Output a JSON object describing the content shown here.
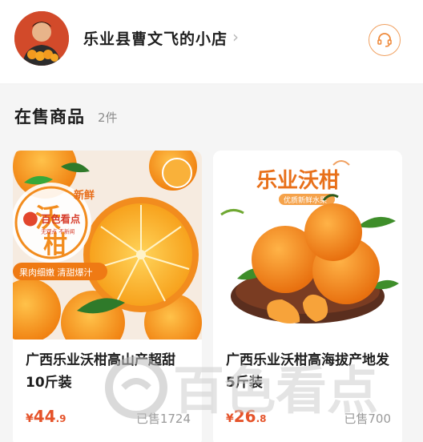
{
  "store": {
    "name": "乐业县曹文飞的小店",
    "chevron_icon": "chevron-right-icon",
    "customer_service_icon": "headset-icon"
  },
  "section": {
    "title": "在售商品",
    "count": "2件"
  },
  "products": [
    {
      "title": "广西乐业沃柑高山产超甜10斤装",
      "currency": "¥",
      "price_int": "44",
      "price_dec": ".9",
      "sold": "已售1724",
      "image_text": {
        "badge_fresh": "新鲜",
        "badge_char1": "沃",
        "badge_char2": "柑",
        "slogan": "果肉细嫩 清甜爆汁"
      }
    },
    {
      "title": "广西乐业沃柑高海拔产地发5斤装",
      "currency": "¥",
      "price_int": "26",
      "price_dec": ".8",
      "sold": "已售700",
      "image_text": {
        "headline": "乐业沃柑",
        "sub": "优质新鲜水果"
      }
    }
  ],
  "watermark": {
    "text": "百色看点",
    "small_text": "百色看点",
    "tagline": "无观点 不新闻"
  },
  "colors": {
    "accent": "#e5532a",
    "orange": "#f28c1e",
    "cs_border": "#f0a060"
  }
}
